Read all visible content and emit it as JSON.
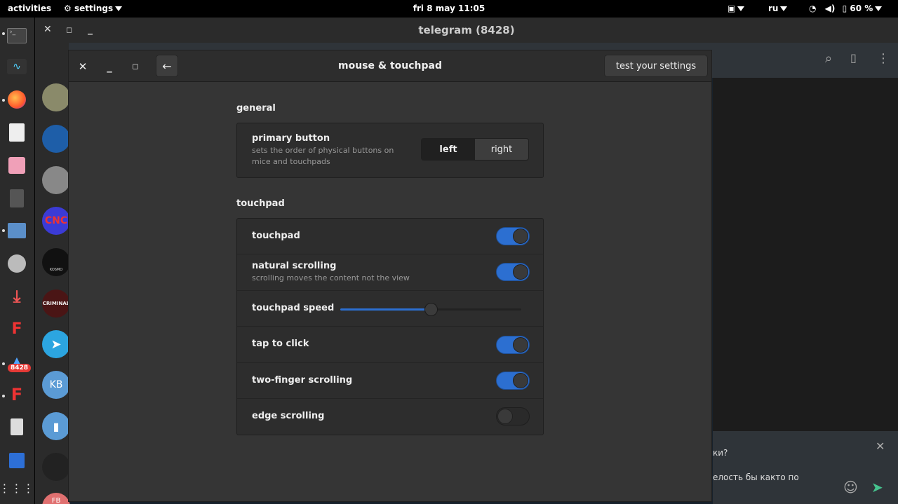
{
  "topbar": {
    "activities": "activities",
    "app_menu": "settings",
    "clock": "fri 8 may  11:05",
    "lang": "ru",
    "battery": "60 %"
  },
  "dock": {
    "badge": "8428",
    "avatars": [
      "CNC",
      "KOSMO",
      "CRIMINAL",
      "KB",
      "FB"
    ]
  },
  "telegram": {
    "title": "telegram (8428)",
    "compose_line1": "ки?",
    "compose_line2": "елость бы както по"
  },
  "settings_window": {
    "title": "mouse & touchpad",
    "test_button": "test your settings",
    "general": {
      "heading": "general",
      "primary_button": {
        "label": "primary button",
        "description": "sets the order of physical buttons on mice and touchpads",
        "options": [
          "left",
          "right"
        ],
        "selected": "left"
      }
    },
    "touchpad": {
      "heading": "touchpad",
      "rows": [
        {
          "label": "touchpad",
          "type": "toggle",
          "on": true
        },
        {
          "label": "natural scrolling",
          "description": "scrolling moves the content not the view",
          "type": "toggle",
          "on": true
        },
        {
          "label": "touchpad speed",
          "type": "slider",
          "value": 0.5
        },
        {
          "label": "tap to click",
          "type": "toggle",
          "on": true
        },
        {
          "label": "two-finger scrolling",
          "type": "toggle",
          "on": true
        },
        {
          "label": "edge scrolling",
          "type": "toggle",
          "on": false
        }
      ]
    }
  },
  "colors": {
    "accent": "#2c6fd1",
    "window_bg": "#353535",
    "panel_bg": "#2d2d2d"
  }
}
